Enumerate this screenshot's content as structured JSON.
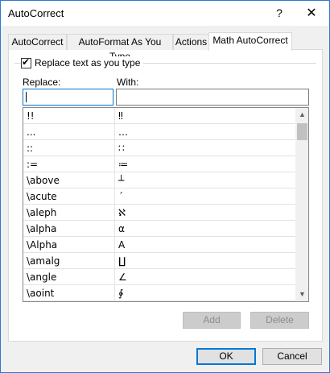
{
  "window": {
    "title": "AutoCorrect",
    "help_glyph": "?",
    "close_glyph": "✕"
  },
  "tabs": [
    {
      "label": "AutoCorrect"
    },
    {
      "label": "AutoFormat As You Type"
    },
    {
      "label": "Actions"
    },
    {
      "label": "Math AutoCorrect"
    }
  ],
  "active_tab": "Math AutoCorrect",
  "replace_as_you_type": {
    "label": "Replace text as you type",
    "checked": true
  },
  "fields": {
    "replace_label": "Replace:",
    "with_label": "With:",
    "replace_value": "",
    "with_value": ""
  },
  "entries": [
    {
      "replace": "!!",
      "with": "‼"
    },
    {
      "replace": "...",
      "with": "…"
    },
    {
      "replace": "::",
      "with": "∷"
    },
    {
      "replace": ":=",
      "with": "≔"
    },
    {
      "replace": "\\above",
      "with": "┴"
    },
    {
      "replace": "\\acute",
      "with": "´"
    },
    {
      "replace": "\\aleph",
      "with": "ℵ"
    },
    {
      "replace": "\\alpha",
      "with": "α"
    },
    {
      "replace": "\\Alpha",
      "with": "A"
    },
    {
      "replace": "\\amalg",
      "with": "∐"
    },
    {
      "replace": "\\angle",
      "with": "∠"
    },
    {
      "replace": "\\aoint",
      "with": "∳"
    }
  ],
  "buttons": {
    "add": "Add",
    "delete": "Delete",
    "ok": "OK",
    "cancel": "Cancel"
  },
  "colors": {
    "accent": "#0078d7",
    "window_border": "#2b79d3",
    "dialog_bg": "#f0f0f0"
  }
}
